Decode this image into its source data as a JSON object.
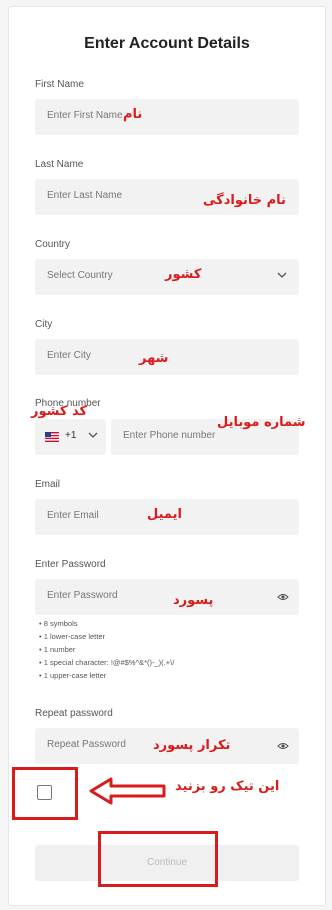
{
  "title": "Enter Account Details",
  "first_name": {
    "label": "First Name",
    "placeholder": "Enter First Name",
    "annotation": "نام"
  },
  "last_name": {
    "label": "Last Name",
    "placeholder": "Enter Last Name",
    "annotation": "نام خانوادگی"
  },
  "country": {
    "label": "Country",
    "placeholder": "Select Country",
    "annotation": "کشور"
  },
  "city": {
    "label": "City",
    "placeholder": "Enter City",
    "annotation": "شهر"
  },
  "phone": {
    "label": "Phone number",
    "code": "+1",
    "placeholder": "Enter Phone number",
    "code_annotation": "کد کشور",
    "annotation": "شماره موبایل"
  },
  "email": {
    "label": "Email",
    "placeholder": "Enter Email",
    "annotation": "ایمیل"
  },
  "password": {
    "label": "Enter Password",
    "placeholder": "Enter Password",
    "annotation": "پسورد",
    "rules": [
      "8 symbols",
      "1 lower-case letter",
      "1 number",
      "1 special character: !@#$%^&*()-_)(.+\\/",
      "1 upper-case letter"
    ]
  },
  "repeat_password": {
    "label": "Repeat password",
    "placeholder": "Repeat Password",
    "annotation": "تکرار پسورد"
  },
  "checkbox_annotation": "این تیک رو بزنید",
  "continue_label": "Continue",
  "colors": {
    "annotation_red": "#d81c1c",
    "field_bg": "#f2f2f2"
  }
}
